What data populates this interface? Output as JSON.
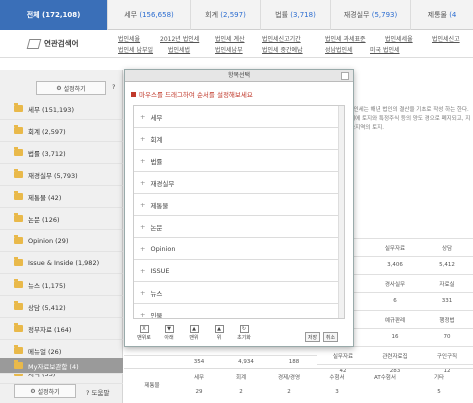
{
  "tabs": [
    {
      "label": "전체",
      "count": "(172,108)",
      "active": true
    },
    {
      "label": "세무",
      "count": "(156,658)",
      "active": false
    },
    {
      "label": "회계",
      "count": "(2,597)",
      "active": false
    },
    {
      "label": "법률",
      "count": "(3,718)",
      "active": false
    },
    {
      "label": "재경실무",
      "count": "(5,793)",
      "active": false
    },
    {
      "label": "제통물",
      "count": "(4",
      "active": false
    }
  ],
  "related": {
    "label": "연관검색어",
    "links": [
      "법인세율",
      "2012년 법인세",
      "법인세 계산",
      "법인세신고기간",
      "법인세 과세표준",
      "법인세세율",
      "법인세신고",
      "법인세 납부일",
      "법인세법",
      "법인세납부",
      "법인세 중간예납",
      "성남법인세",
      "미국 법인세"
    ]
  },
  "left": {
    "setting_label": "설정하기",
    "tree": [
      {
        "label": "세무 (151,193)"
      },
      {
        "label": "회계 (2,597)"
      },
      {
        "label": "법률 (3,712)"
      },
      {
        "label": "재경실무 (5,793)"
      },
      {
        "label": "제통물 (42)"
      },
      {
        "label": "논문 (126)"
      },
      {
        "label": "Opinion (29)"
      },
      {
        "label": "Issue & Inside (1,982)"
      },
      {
        "label": "뉴스 (1,175)"
      },
      {
        "label": "상담 (5,412)"
      },
      {
        "label": "정부자료 (164)"
      },
      {
        "label": "메뉴얼 (26)"
      },
      {
        "label": "서식 (53)"
      },
      {
        "label": "My자료보관함 (4)"
      }
    ],
    "help_label": "도움말"
  },
  "content": {
    "desc": "다. 법인세는 해년 법인의 결산을 기초로 작성 하는 한다. 법인세에 토지와 특정주식 등의 양도 경으로 폐지되고, 지가상승지역의 토지.",
    "header1": [
      "세법해설",
      "실무자료",
      "상담"
    ],
    "row1": [
      "6,284",
      "3,406",
      "5,412"
    ],
    "header2": [
      "예규판례",
      "경사실무",
      "자료실"
    ],
    "row2": [
      "84",
      "6",
      "331"
    ],
    "header3": [
      "판례",
      "예규판례",
      "행정법"
    ],
    "row3": [
      "2,154",
      "16",
      "70"
    ],
    "header4": [
      "실무자료",
      "관련자료집",
      "구인구직"
    ],
    "row4": [
      "42",
      "283",
      "12"
    ],
    "side_label": "제통물",
    "footer_cols": [
      "세무",
      "회계",
      "경제/경영",
      "수험서",
      "AT수험서",
      "기타"
    ],
    "footer_vals": [
      "29",
      "2",
      "2",
      "3",
      "",
      "5"
    ],
    "partial_row": [
      "354",
      "4,934",
      "188"
    ]
  },
  "modal": {
    "title": "항목선택",
    "hint": "마우스를 드래그하여 순서를 설정해보세요",
    "items": [
      "세무",
      "회계",
      "법률",
      "재경실무",
      "제통물",
      "논문",
      "Opinion",
      "ISSUE",
      "뉴스",
      "인물"
    ],
    "tools": [
      {
        "icon": "X",
        "label": "맨위로"
      },
      {
        "icon": "▼",
        "label": "아래"
      },
      {
        "icon": "▲",
        "label": "맨위"
      },
      {
        "icon": "▲",
        "label": "위"
      },
      {
        "icon": "↻",
        "label": "초기화"
      }
    ],
    "save_label": "저장",
    "cancel_label": "취소"
  }
}
